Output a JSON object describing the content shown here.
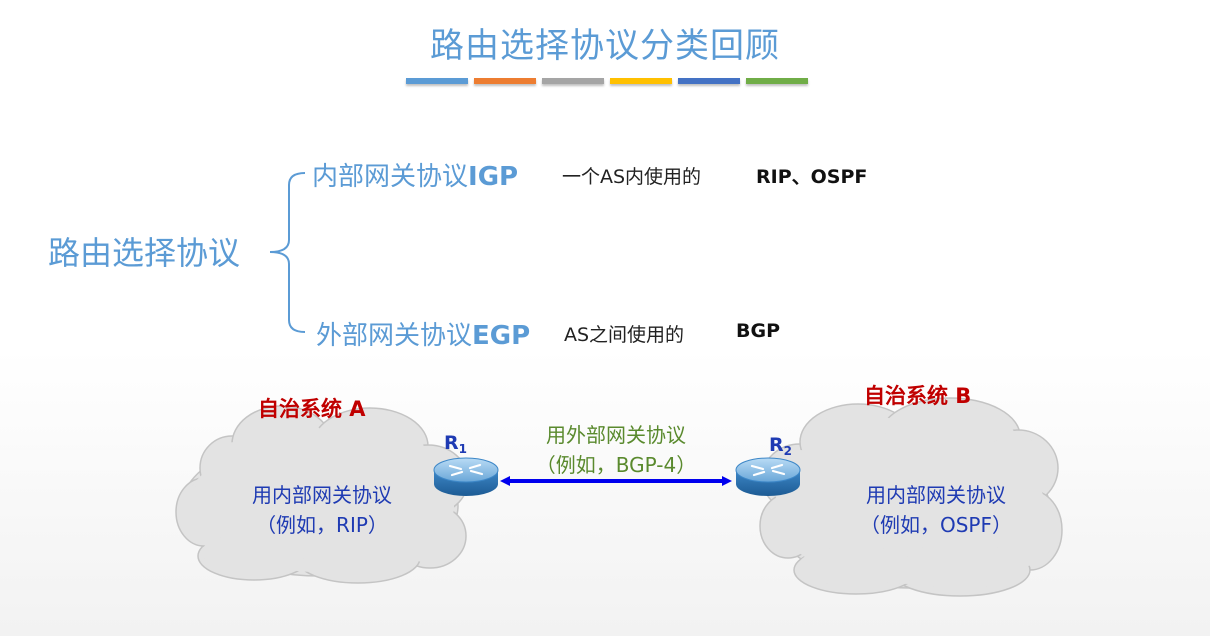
{
  "title": "路由选择协议分类回顾",
  "title_bar_colors": [
    "#5b9bd5",
    "#ed7d31",
    "#a5a5a5",
    "#ffc000",
    "#4472c4",
    "#70ad47"
  ],
  "root": {
    "label": "路由选择协议"
  },
  "igp": {
    "label": "内部网关协议",
    "abbr": "IGP",
    "desc": "一个AS内使用的",
    "examples": "RIP、OSPF"
  },
  "egp": {
    "label": "外部网关协议",
    "abbr": "EGP",
    "desc": "AS之间使用的",
    "examples": "BGP"
  },
  "as_a": {
    "title": "自治系统 A",
    "line1": "用内部网关协议",
    "line2": "（例如，RIP）"
  },
  "as_b": {
    "title": "自治系统 B",
    "line1": "用内部网关协议",
    "line2": "（例如，OSPF）"
  },
  "r1": {
    "name": "R",
    "sub": "1"
  },
  "r2": {
    "name": "R",
    "sub": "2"
  },
  "link": {
    "line1": "用外部网关协议",
    "line2": "（例如，BGP-4）"
  },
  "colors": {
    "accent_blue": "#5b9bd5",
    "as_red": "#c00000",
    "router_blue": "#1f3bb3",
    "link_green": "#5a8a2e",
    "arrow_blue": "#0000ee"
  }
}
